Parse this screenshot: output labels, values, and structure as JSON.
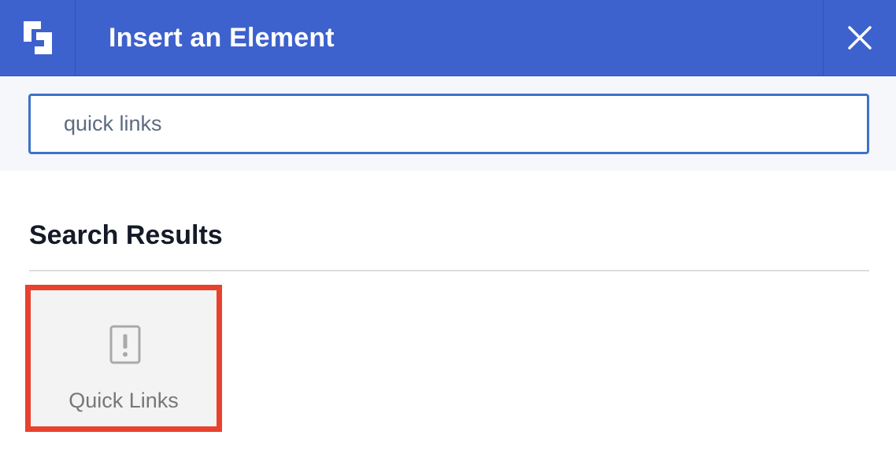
{
  "header": {
    "title": "Insert an Element",
    "logo_icon": "brand-logo-icon",
    "close_icon": "close-icon",
    "background_color": "#3d61cd"
  },
  "search": {
    "value": "quick links",
    "border_color": "#3d72c9"
  },
  "results": {
    "heading": "Search Results",
    "items": [
      {
        "label": "Quick Links",
        "icon": "alert-document-icon",
        "highlight_color": "#e8412d"
      }
    ]
  }
}
